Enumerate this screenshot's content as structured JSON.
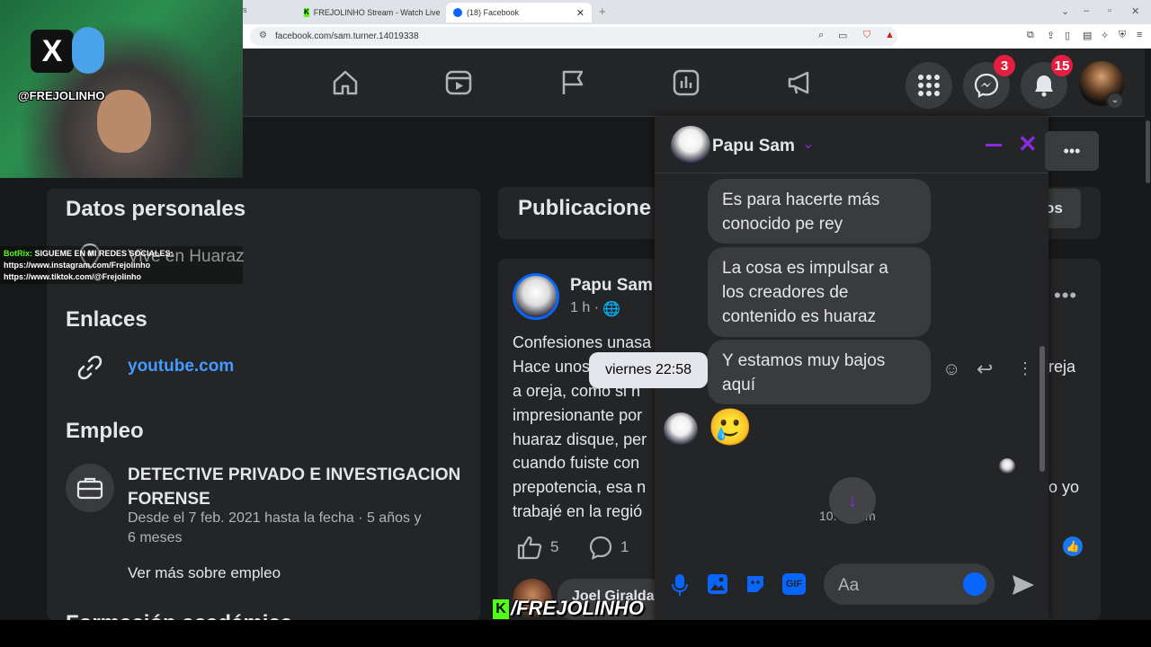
{
  "browser": {
    "tabs": [
      {
        "label": "FREJOLINHO Stream - Watch Live on"
      },
      {
        "label": "(18) Facebook"
      }
    ],
    "url": "facebook.com/sam.turner.14019338",
    "partial_tab": "s"
  },
  "fb_nav": {
    "messenger_badge": "3",
    "notifications_badge": "15"
  },
  "about": {
    "personal_title": "Datos personales",
    "lives_in": "Vive en Huaraz",
    "links_title": "Enlaces",
    "link": "youtube.com",
    "work_title": "Empleo",
    "job_title_line1": "DETECTIVE PRIVADO E INVESTIGACION",
    "job_title_line2": "FORENSE",
    "job_dates_line1": "Desde el 7 feb. 2021 hasta la fecha · 5 años y",
    "job_dates_line2": "6 meses",
    "see_more_work": "Ver más sobre empleo",
    "next_title_partial": "Formación académica"
  },
  "posts": {
    "section_title": "Publicacione",
    "filter_button_partial": "os",
    "author": "Papu Sam",
    "time": "1 h ·",
    "lines": [
      "Confesiones unasa",
      "Hace unos",
      "a oreja, como si n",
      "impresionante por",
      "huaraz disque, per",
      "cuando fuiste con",
      "prepotencia, esa n",
      "trabajé en la regió"
    ],
    "right_fragment_1": "reja",
    "right_fragment_2": "o yo",
    "likes": "5",
    "comments": "1",
    "commenter_partial": "Joel Giralda"
  },
  "chat": {
    "contact_name": "Papu Sam",
    "messages": [
      {
        "text_line1": "Es para hacerte más",
        "text_line2": "conocido pe rey"
      },
      {
        "text_line1": "La cosa es impulsar a",
        "text_line2": "los creadores de",
        "text_line3": "contenido es huaraz"
      },
      {
        "text_line1": "Y estamos muy bajos",
        "text_line2": "aquí"
      }
    ],
    "emoji_message": "🥲",
    "tooltip": "viernes 22:58",
    "time_partial": "10:",
    "time_partial_suffix": "m",
    "input_placeholder": "Aa"
  },
  "overlay": {
    "stream_handle": "@FREJOLINHO",
    "bot_name": "BotRix:",
    "bot_message": "SIGUEME EN MI REDES SOCIALES:",
    "instagram": "https://www.instagram.com/Frejolinho",
    "tiktok": "https://www.tiktok.com/@Frejolinho",
    "watermark": "/FREJOLINHO"
  },
  "colors": {
    "fb_bg": "#18191a",
    "card": "#242526",
    "accent_purple": "#8a2be2",
    "fb_blue": "#0866ff",
    "link_blue": "#4599ff"
  }
}
